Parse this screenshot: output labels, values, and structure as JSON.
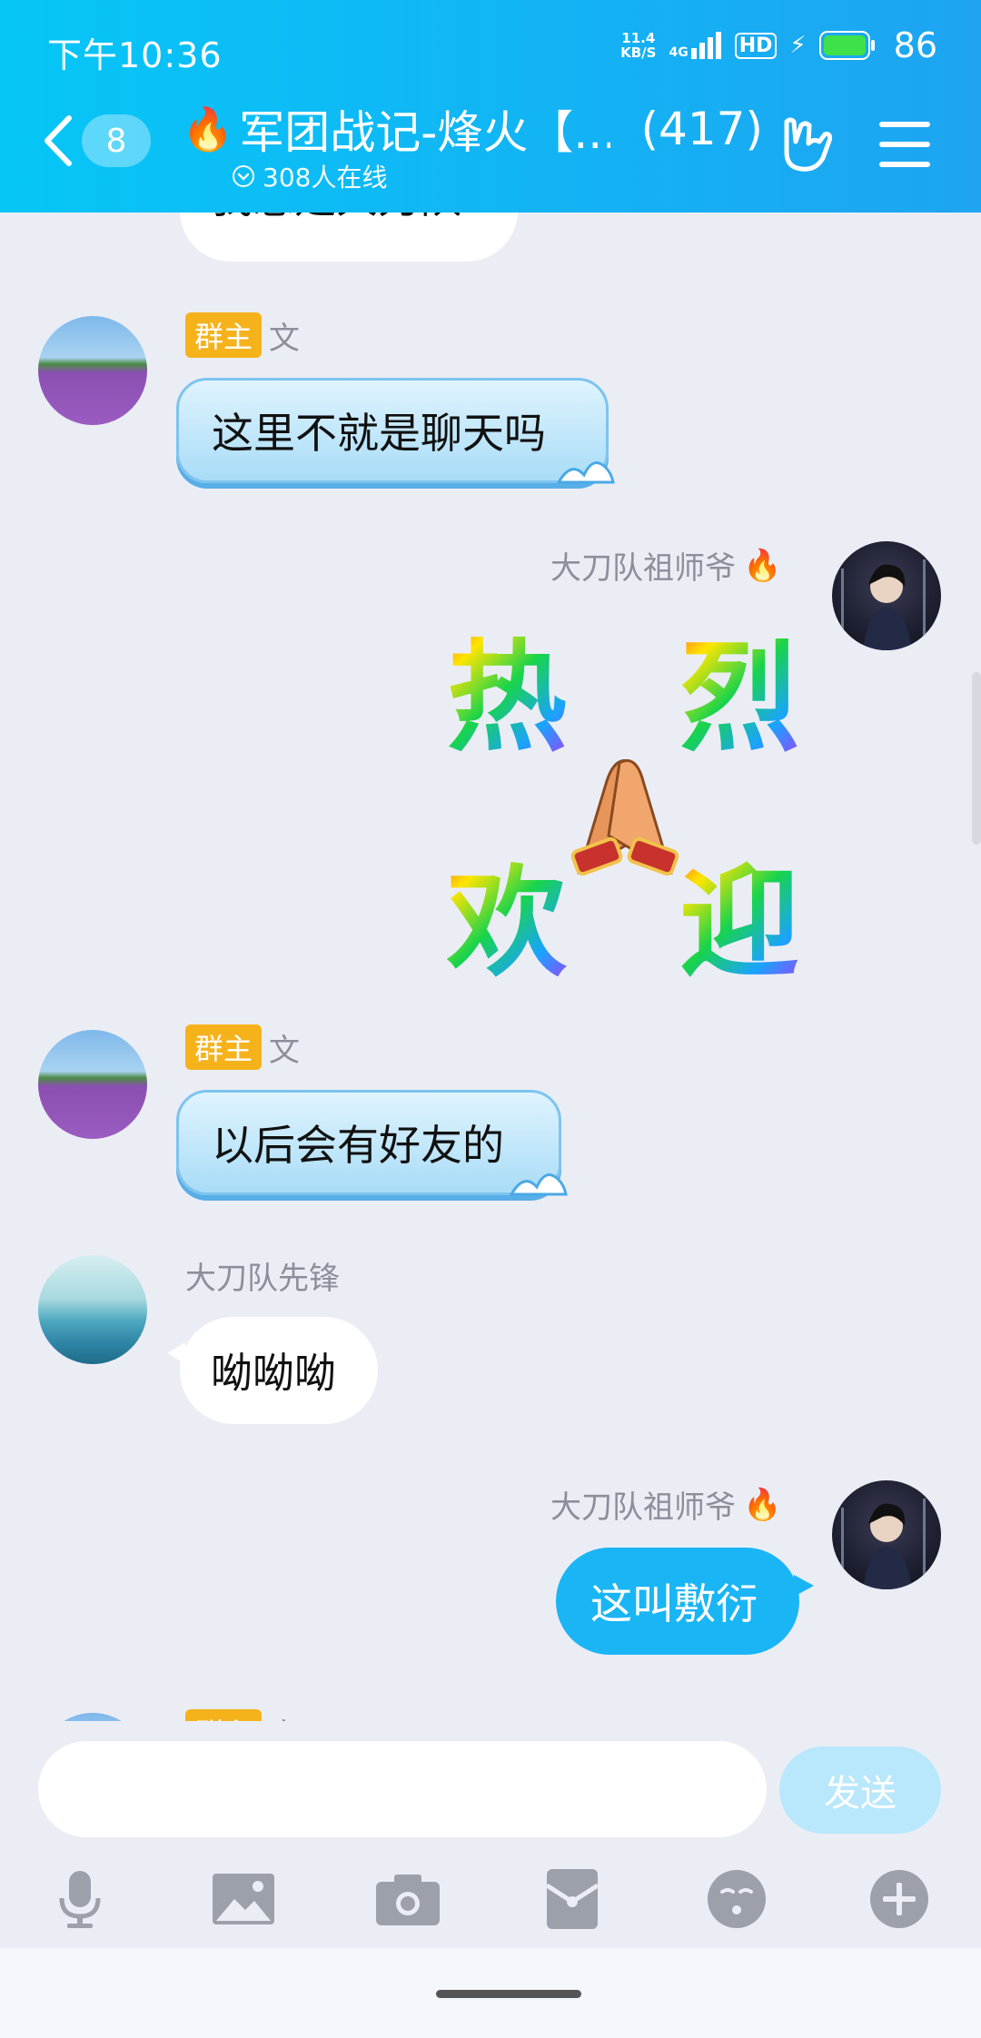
{
  "status": {
    "time": "下午10:36",
    "net_speed_value": "11.4",
    "net_speed_unit": "KB/S",
    "network": "4G",
    "hd": "HD",
    "battery": "86"
  },
  "header": {
    "back_badge": "8",
    "title": "军团战记-烽火【...",
    "member_count": "(417)",
    "online": "308人在线"
  },
  "messages": [
    {
      "id": "m0",
      "sender": "",
      "tag": "",
      "text": "我总是大刀队",
      "side": "left"
    },
    {
      "id": "m1",
      "sender": "文",
      "tag": "群主",
      "text": "这里不就是聊天吗",
      "side": "left"
    },
    {
      "id": "m2",
      "sender": "大刀队祖师爷",
      "tag": "",
      "sticker": [
        "热",
        "烈",
        "欢",
        "迎"
      ],
      "side": "right"
    },
    {
      "id": "m3",
      "sender": "文",
      "tag": "群主",
      "text": "以后会有好友的",
      "side": "left"
    },
    {
      "id": "m4",
      "sender": "大刀队先锋",
      "tag": "",
      "text": "呦呦呦",
      "side": "left"
    },
    {
      "id": "m5",
      "sender": "大刀队祖师爷",
      "tag": "",
      "text": "这叫敷衍",
      "side": "right"
    },
    {
      "id": "m6",
      "sender": "文",
      "tag": "群主",
      "text": "",
      "side": "left"
    }
  ],
  "composer": {
    "send_label": "发送",
    "input_value": ""
  },
  "toolbar_icons": [
    "microphone-icon",
    "image-icon",
    "camera-icon",
    "red-packet-icon",
    "emoji-icon",
    "plus-icon"
  ],
  "colors": {
    "header_start": "#06c6f7",
    "header_end": "#1ea4f1",
    "self_bubble": "#1ab5f5",
    "owner_tag": "#f5b21b",
    "send_disabled": "#b9e7fb"
  }
}
